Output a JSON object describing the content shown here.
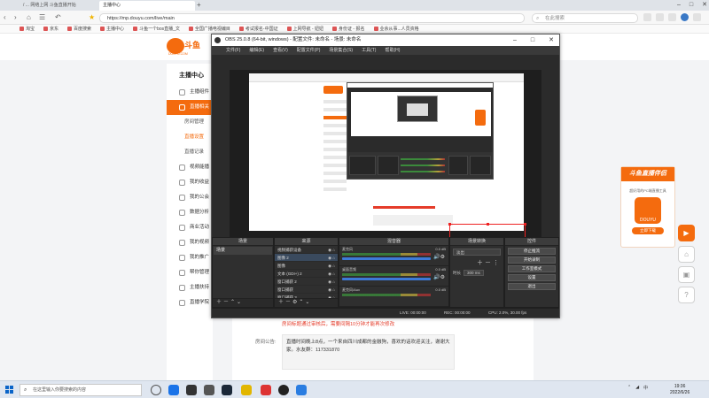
{
  "browser": {
    "tabs": [
      {
        "label": "/ ... 网络上网 斗鱼直播开始"
      },
      {
        "label": "主播中心"
      }
    ],
    "url": "https://mp.douyu.com/live/main",
    "search_placeholder": "在此搜索",
    "bookmarks": [
      "淘宝",
      "京东",
      "百度搜索",
      "主播中心",
      "斗鱼一个bos直播_文",
      "全国广播电视编目",
      "考试报名-中国证",
      "上网导航 - 妞妞",
      "身份证 - 报名",
      "业余从事...人员资格"
    ]
  },
  "page": {
    "logo_text": "斗鱼",
    "logo_sub": "DOUYU.COM",
    "sidebar_title": "主播中心",
    "sidebar_items": [
      {
        "label": "主播组件"
      },
      {
        "label": "直播相关"
      },
      {
        "label": "房间管理"
      },
      {
        "label": "直播设置"
      },
      {
        "label": "直播记录"
      },
      {
        "label": "视频能播"
      },
      {
        "label": "我的收益"
      },
      {
        "label": "我的公会"
      },
      {
        "label": "数据分析"
      },
      {
        "label": "商业活动"
      },
      {
        "label": "我的视频"
      },
      {
        "label": "我的推广"
      },
      {
        "label": "帮你管理"
      },
      {
        "label": "主播扶持"
      },
      {
        "label": "直播学院"
      }
    ],
    "notice": "房间标题通过审核后，需要间隔10分钟才能再次修改",
    "announcement_label": "房间公告:",
    "announcement_text": "直播时间晚上8点，一个来自四川成都的金融狗，喜欢的话欢迎关注，谢谢大家。水友群：117331870"
  },
  "promo": {
    "header": "斗鱼直播伴侣",
    "desc": "超好用的PC端直播工具",
    "icon_label": "DOUYU",
    "button": "立即下载"
  },
  "obs": {
    "title": "OBS 25.0.8 (64-bit, windows) - 配置文件: 未命名 - 场景: 未命名",
    "menu": [
      "文件(F)",
      "编辑(E)",
      "查看(V)",
      "配置文件(P)",
      "场景集合(S)",
      "工具(T)",
      "帮助(H)"
    ],
    "docks": {
      "scenes_title": "场景",
      "sources_title": "来源",
      "mixer_title": "混音器",
      "transitions_title": "场景转换",
      "controls_title": "控件"
    },
    "scenes": [
      "场景"
    ],
    "sources": [
      "视频捕获设备",
      "图像 2",
      "图像",
      "文本 (GDI+) 2",
      "窗口捕获 2",
      "窗口捕获",
      "窗口捕获 3",
      "显示器捕获"
    ],
    "mixer": [
      {
        "name": "麦克风",
        "db": "0.0 dB"
      },
      {
        "name": "桌面音频",
        "db": "0.0 dB"
      },
      {
        "name": "麦克风/Aux",
        "db": "0.0 dB"
      }
    ],
    "transition": {
      "type": "淡出",
      "duration_label": "时长",
      "duration": "300 ms"
    },
    "controls": [
      "停止推流",
      "开始录制",
      "工作室模式",
      "设置",
      "退出"
    ],
    "status": {
      "live": "LIVE: 00:00:00",
      "rec": "REC: 00:00:00",
      "cpu": "CPU: 2.0%, 30.00 fps"
    }
  },
  "taskbar": {
    "search_placeholder": "在这里输入你要搜索的内容",
    "tray_lang": "中",
    "time": "19:36",
    "date": "2022/6/26"
  },
  "colors": {
    "accent": "#f46b0e",
    "obs_bg": "#2b2b2b",
    "notice": "#e53c2a"
  }
}
